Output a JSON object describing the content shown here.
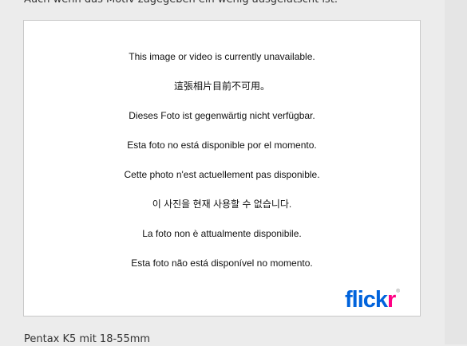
{
  "article": {
    "intro_text": "Auch wenn das Motiv zugegeben ein wenig ausgelutscht ist:",
    "caption": "Pentax K5 mit 18-55mm"
  },
  "embed": {
    "messages": [
      "This image or video is currently unavailable.",
      "這張相片目前不可用。",
      "Dieses Foto ist gegenwärtig nicht verfügbar.",
      "Esta foto no está disponible por el momento.",
      "Cette photo n'est actuellement pas disponible.",
      "이 사진을 현재 사용할 수 없습니다.",
      "La foto non è attualmente disponibile.",
      "Esta foto não está disponível no momento."
    ],
    "logo": {
      "text_part1": "flick",
      "text_part2": "r",
      "registered": "®"
    }
  }
}
